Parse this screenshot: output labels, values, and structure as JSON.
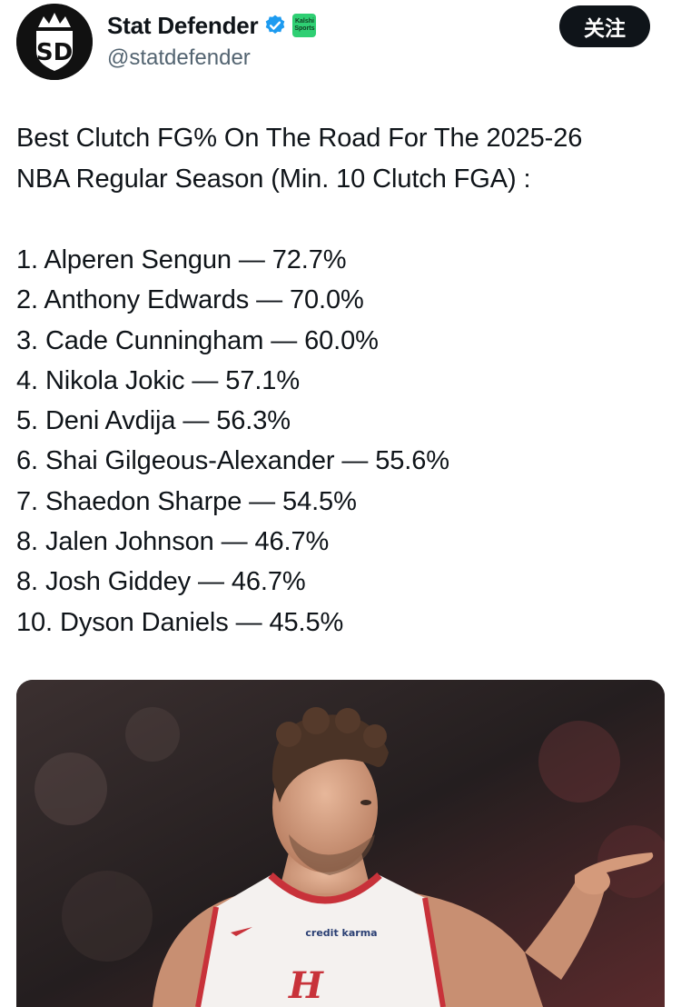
{
  "account": {
    "display_name": "Stat Defender",
    "handle": "@statdefender",
    "avatar_initials": "SD",
    "badge_label": "Kalshi Sports",
    "follow_label": "关注"
  },
  "tweet": {
    "heading_lines": [
      "Best Clutch FG% On The Road For The 2025-26",
      "NBA Regular Season (Min. 10 Clutch FGA) :"
    ],
    "list": [
      "1.  Alperen Sengun — 72.7%",
      "2.  Anthony Edwards — 70.0%",
      "3.  Cade Cunningham — 60.0%",
      "4.  Nikola Jokic — 57.1%",
      "5.  Deni Avdija — 56.3%",
      "6.  Shai Gilgeous-Alexander — 55.6%",
      "7.  Shaedon Sharpe — 54.5%",
      "8.  Jalen Johnson — 46.7%",
      "8.  Josh Giddey — 46.7%",
      "10.  Dyson Daniels — 45.5%"
    ]
  },
  "photo": {
    "jersey_sponsor": "credit karma"
  },
  "colors": {
    "verified": "#1d9bf0",
    "badge": "#2fcf73",
    "button": "#0f1419",
    "handle": "#536471"
  }
}
